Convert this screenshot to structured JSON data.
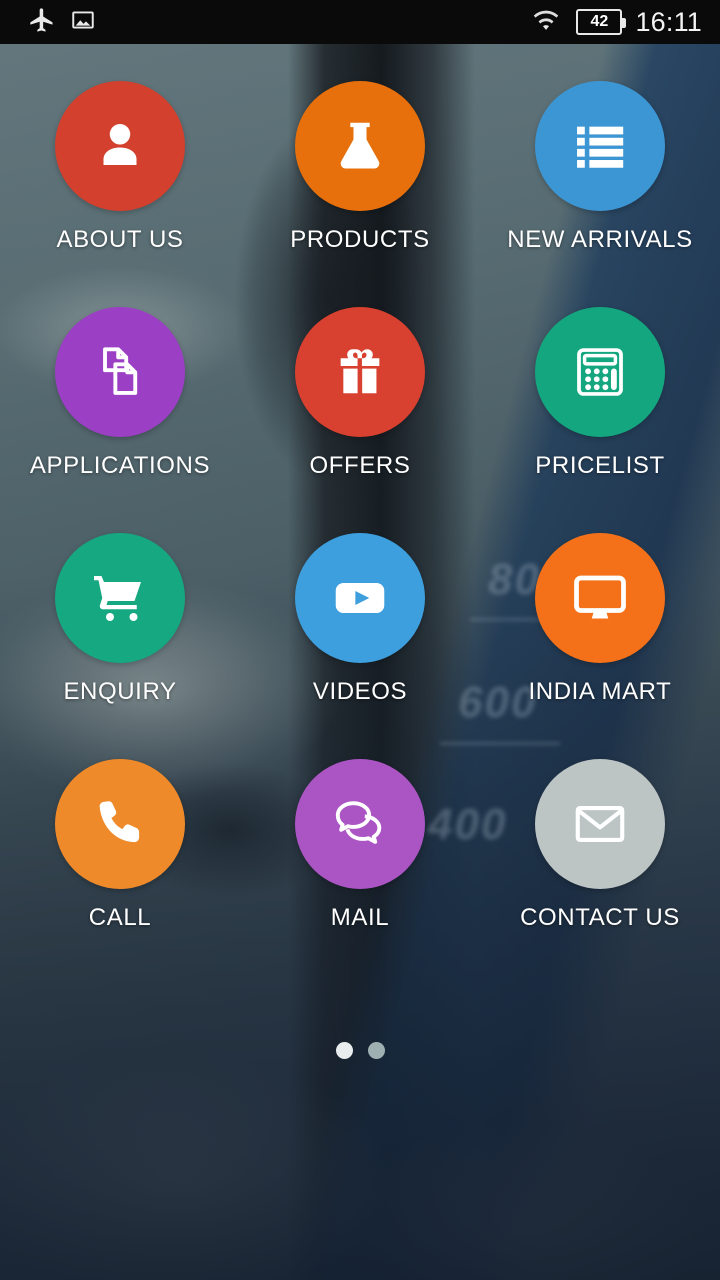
{
  "status_bar": {
    "left_icons": [
      {
        "name": "airplane-mode-icon",
        "label": "Airplane mode"
      },
      {
        "name": "screenshot-icon",
        "label": "Screenshot saved"
      }
    ],
    "wifi_icon": "wifi-icon",
    "battery_level": "42",
    "time": "16:11"
  },
  "home_screen": {
    "items": [
      {
        "label": "ABOUT US",
        "icon": "person-icon",
        "color": "#d3402e"
      },
      {
        "label": "PRODUCTS",
        "icon": "flask-icon",
        "color": "#e8700c"
      },
      {
        "label": "NEW ARRIVALS",
        "icon": "list-icon",
        "color": "#3d96d4"
      },
      {
        "label": "APPLICATIONS",
        "icon": "documents-icon",
        "color": "#9b3fc4"
      },
      {
        "label": "OFFERS",
        "icon": "gift-icon",
        "color": "#d8402f"
      },
      {
        "label": "PRICELIST",
        "icon": "calculator-icon",
        "color": "#13a67f"
      },
      {
        "label": "ENQUIRY",
        "icon": "shopping-cart-icon",
        "color": "#16a881"
      },
      {
        "label": "VIDEOS",
        "icon": "play-button-icon",
        "color": "#3d9fdd"
      },
      {
        "label": "INDIA MART",
        "icon": "monitor-icon",
        "color": "#f4711a"
      },
      {
        "label": "CALL",
        "icon": "phone-icon",
        "color": "#ef8a2a"
      },
      {
        "label": "MAIL",
        "icon": "chat-bubbles-icon",
        "color": "#ab55c4"
      },
      {
        "label": "CONTACT US",
        "icon": "envelope-icon",
        "color": "#bcc4c4"
      }
    ],
    "page_indicator": {
      "total": 2,
      "active": 1
    }
  },
  "wallpaper": {
    "scale_numbers": [
      "800",
      "600",
      "400"
    ]
  }
}
